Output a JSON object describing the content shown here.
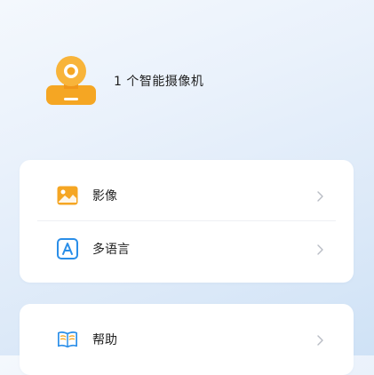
{
  "device": {
    "summary": "1 个智能摄像机"
  },
  "menu": {
    "items": [
      {
        "label": "影像",
        "icon": "image-icon"
      },
      {
        "label": "多语言",
        "icon": "language-icon"
      }
    ],
    "help": {
      "label": "帮助",
      "icon": "book-icon"
    }
  },
  "colors": {
    "accent_orange": "#F5A623",
    "accent_blue": "#2A8EE8"
  }
}
